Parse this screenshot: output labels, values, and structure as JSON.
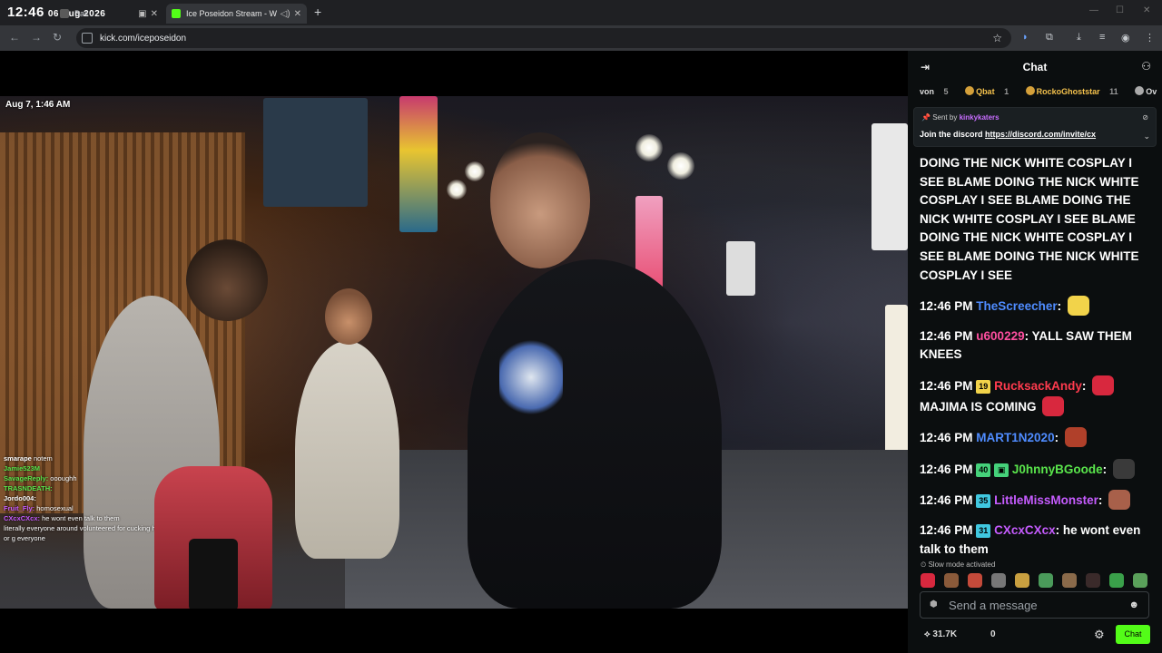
{
  "browser": {
    "clock": "12:46",
    "clock_date": "06 Aug 2026",
    "tabs": [
      {
        "title": "Ball"
      },
      {
        "title": "Ice Poseidon Stream - Watc"
      }
    ],
    "url": "kick.com/iceposeidon"
  },
  "video": {
    "timestamp": "Aug 7, 1:46 AM",
    "overlay_chat": [
      {
        "user": "smarape",
        "text": "notem"
      },
      {
        "user": "Jamie523M",
        "text": ""
      },
      {
        "user": "SavageReply:",
        "text": "oooughh"
      },
      {
        "user": "TRASNDEATH:",
        "text": ""
      },
      {
        "user": "Jordo004:",
        "text": ""
      },
      {
        "user": "Fruit_Fly:",
        "text": "homosexual"
      },
      {
        "user": "CXcxCXcx:",
        "text": "he wont even talk to them"
      },
      {
        "user": "",
        "text": "literally everyone around volunteered for cucking humiliation or g everyone"
      }
    ]
  },
  "chat": {
    "title": "Chat",
    "gifters": [
      {
        "name": "von",
        "count": "5"
      },
      {
        "name": "Qbat",
        "count": "1"
      },
      {
        "name": "RockoGhoststar",
        "count": "11"
      },
      {
        "name": "Ov",
        "count": ""
      }
    ],
    "pinned": {
      "sent_by_label": "Sent by",
      "sent_by_user": "kinkykaters",
      "text": "Join the discord",
      "link": "https://discord.com/invite/cx"
    },
    "overflow_text": "DOING THE NICK WHITE COSPLAY I SEE BLAME DOING THE NICK WHITE COSPLAY I SEE BLAME DOING THE NICK WHITE COSPLAY I SEE BLAME DOING THE NICK WHITE COSPLAY I SEE BLAME DOING THE NICK WHITE COSPLAY I SEE",
    "messages": [
      {
        "time": "12:46 PM",
        "badge": "",
        "user": "TheScreecher",
        "color": "#4f8cff",
        "text": ""
      },
      {
        "time": "12:46 PM",
        "badge": "",
        "user": "u600229",
        "color": "#ff4fa0",
        "text": "YALL SAW THEM KNEES"
      },
      {
        "time": "12:46 PM",
        "badge": "19",
        "user": "RucksackAndy",
        "color": "#ff3b4e",
        "text": "MAJIMA IS COMING"
      },
      {
        "time": "12:46 PM",
        "badge": "",
        "user": "MART1N2020",
        "color": "#4f8cff",
        "text": ""
      },
      {
        "time": "12:46 PM",
        "badge": "40",
        "user": "J0hnnyBGoode",
        "color": "#5ae64c",
        "text": ""
      },
      {
        "time": "12:46 PM",
        "badge": "35",
        "user": "LittleMissMonster",
        "color": "#c65cff",
        "text": ""
      },
      {
        "time": "12:46 PM",
        "badge": "31",
        "user": "CXcxCXcx",
        "color": "#c65cff",
        "text": "he wont even talk to them"
      }
    ],
    "slow_mode": "Slow mode activated",
    "input_placeholder": "Send a message",
    "viewers": "31.7K",
    "zero": "0",
    "chat_button": "Chat"
  }
}
